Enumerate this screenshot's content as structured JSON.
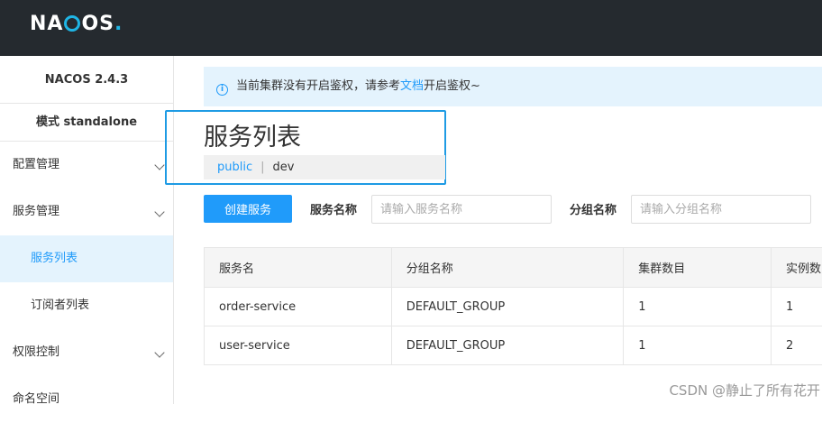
{
  "header": {
    "logo_text": "NACOS"
  },
  "sidebar": {
    "version": "NACOS 2.4.3",
    "mode": "模式 standalone",
    "items": [
      {
        "label": "配置管理"
      },
      {
        "label": "服务管理"
      },
      {
        "label": "服务列表"
      },
      {
        "label": "订阅者列表"
      },
      {
        "label": "权限控制"
      },
      {
        "label": "命名空间"
      }
    ]
  },
  "notice": {
    "text_before": "当前集群没有开启鉴权，请参考",
    "link": "文档",
    "text_after": "开启鉴权~"
  },
  "page": {
    "title": "服务列表",
    "namespaces": [
      "public",
      "dev"
    ],
    "separator": "|"
  },
  "filters": {
    "create_button": "创建服务",
    "service_name_label": "服务名称",
    "service_name_placeholder": "请输入服务名称",
    "group_name_label": "分组名称",
    "group_name_placeholder": "请输入分组名称"
  },
  "table": {
    "headers": [
      "服务名",
      "分组名称",
      "集群数目",
      "实例数"
    ],
    "rows": [
      [
        "order-service",
        "DEFAULT_GROUP",
        "1",
        "1"
      ],
      [
        "user-service",
        "DEFAULT_GROUP",
        "1",
        "2"
      ]
    ]
  },
  "watermark": "CSDN @静止了所有花开",
  "colors": {
    "accent": "#209bfa",
    "topbar": "#252a2f",
    "highlight_border": "#1e9be4"
  }
}
